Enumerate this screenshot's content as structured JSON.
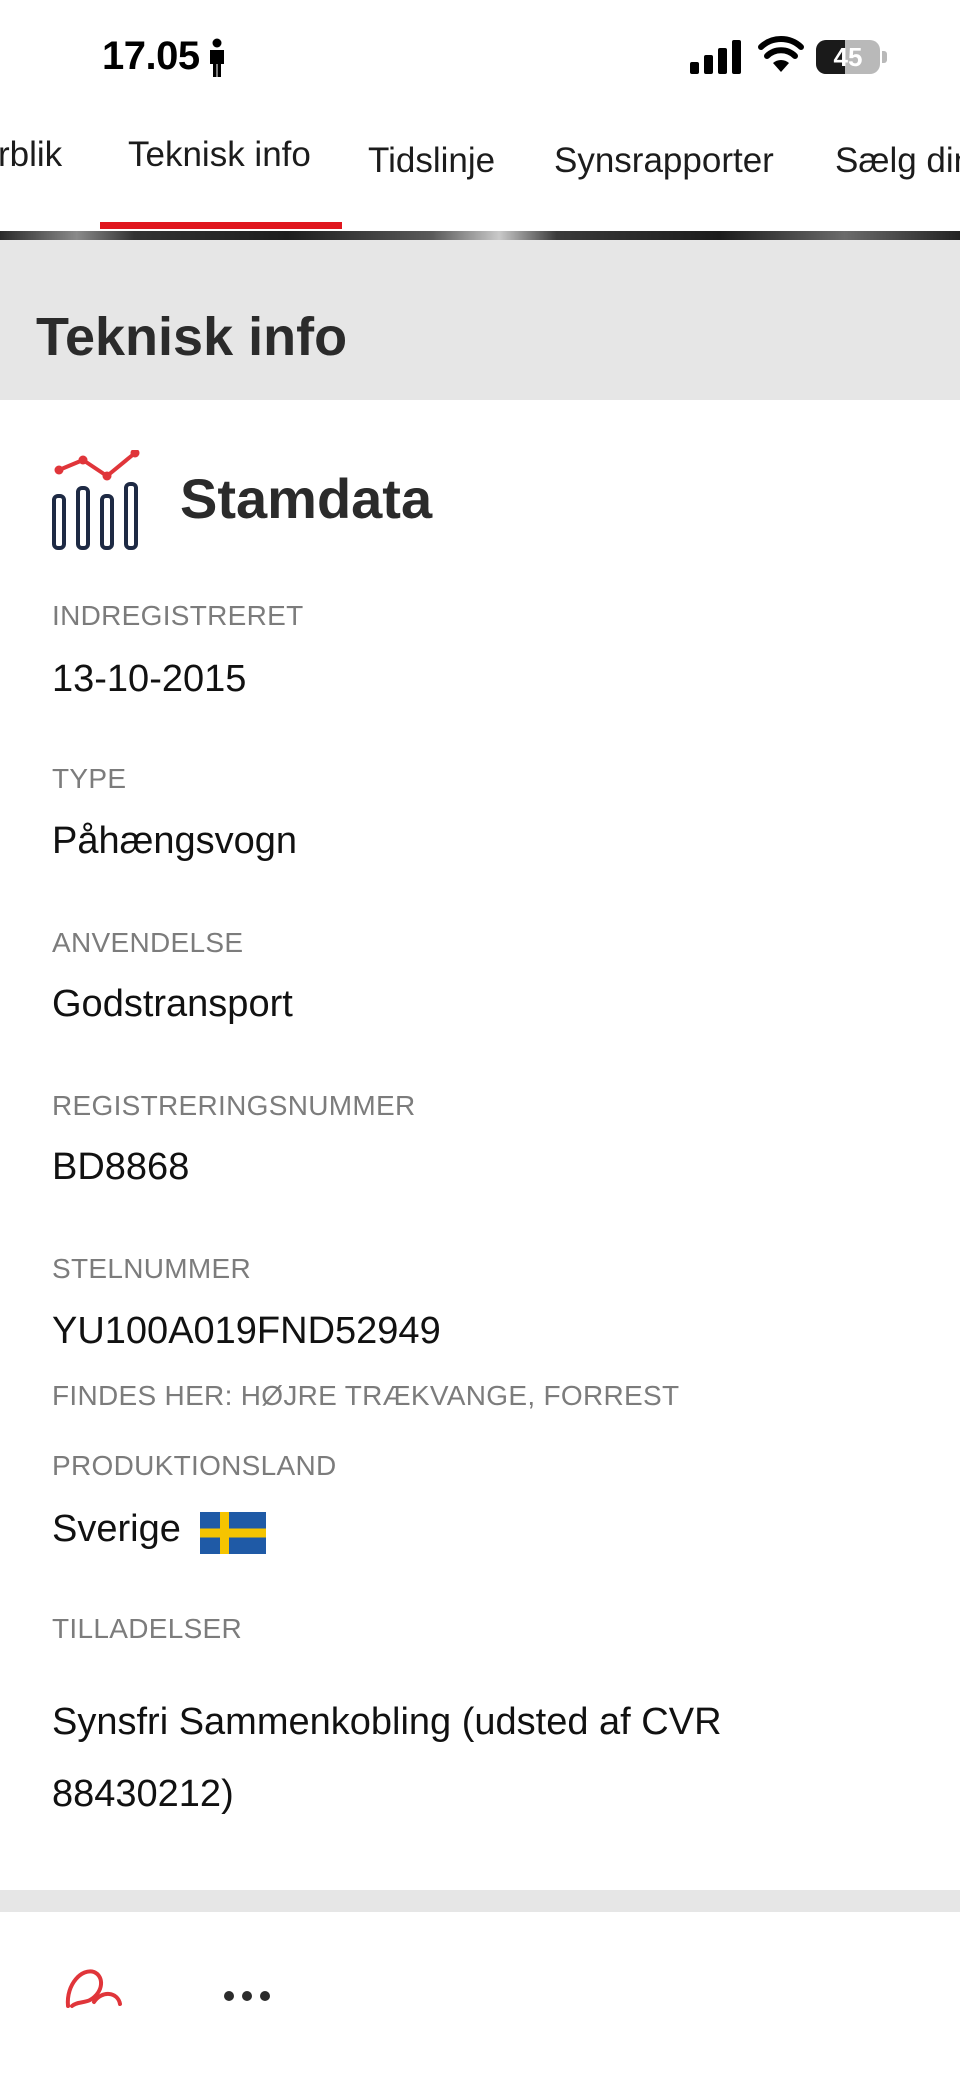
{
  "status_bar": {
    "time": "17.05",
    "battery_level": "45",
    "battery_fraction": 0.45,
    "icons": [
      "person-icon",
      "signal-icon",
      "wifi-icon",
      "battery-icon"
    ]
  },
  "tabs": [
    {
      "label": "Overblik",
      "visible_text": "rblik",
      "active": false
    },
    {
      "label": "Teknisk info",
      "visible_text": "Teknisk info",
      "active": true
    },
    {
      "label": "Tidslinje",
      "visible_text": "Tidslinje",
      "active": false
    },
    {
      "label": "Synsrapporter",
      "visible_text": "Synsrapporter",
      "active": false
    },
    {
      "label": "Sælg din bil",
      "visible_text": "Sælg din",
      "active": false
    }
  ],
  "section": {
    "title": "Teknisk info"
  },
  "card": {
    "icon": "chart-trend-icon",
    "title": "Stamdata",
    "fields": {
      "registered": {
        "label": "INDREGISTRERET",
        "value": "13-10-2015"
      },
      "type": {
        "label": "TYPE",
        "value": "Påhængsvogn"
      },
      "usage": {
        "label": "ANVENDELSE",
        "value": "Godstransport"
      },
      "registration_number": {
        "label": "REGISTRERINGSNUMMER",
        "value": "BD8868"
      },
      "vin": {
        "label": "STELNUMMER",
        "value": "YU100A019FND52949",
        "note": "FINDES HER: HØJRE TRÆKVANGE, FORREST"
      },
      "production_country": {
        "label": "PRODUKTIONSLAND",
        "value": "Sverige",
        "flag_icon": "sweden-flag-icon"
      },
      "permits": {
        "label": "TILLADELSER",
        "value": "Synsfri Sammenkobling (udsted af CVR 88430212)"
      }
    }
  },
  "bottom_bar": {
    "icons": [
      "leaf-icon",
      "more-icon"
    ]
  },
  "colors": {
    "accent": "#e0161e",
    "header_background": "#e6e6e6",
    "label_gray": "#7c7c7c",
    "icon_navy": "#1e2a44",
    "flag_blue": "#1f5aa6",
    "flag_yellow": "#f5c400"
  }
}
